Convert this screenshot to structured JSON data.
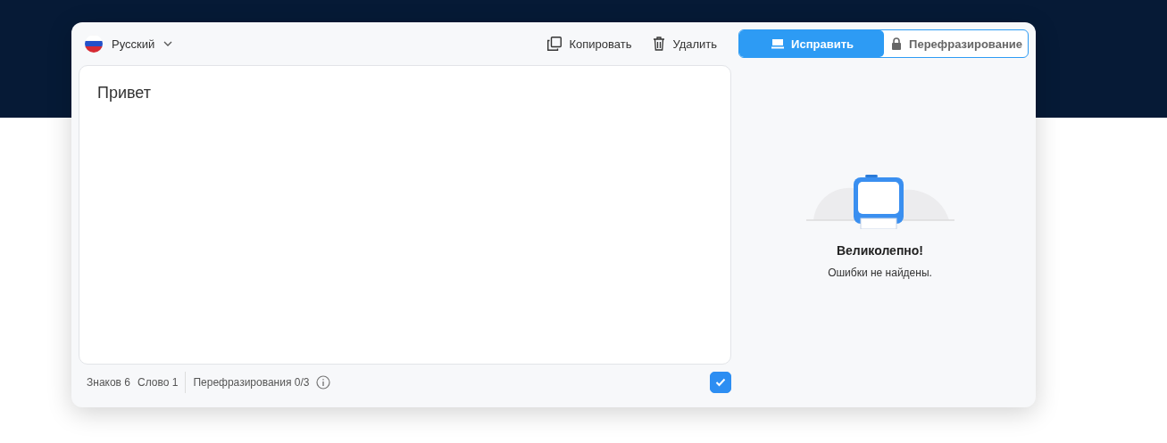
{
  "language": {
    "label": "Русский"
  },
  "actions": [
    {
      "label": "Копировать",
      "kind": "copy"
    },
    {
      "label": "Удалить",
      "kind": "delete"
    }
  ],
  "tabs": [
    {
      "label": "Исправить",
      "selected": true,
      "locked": false
    },
    {
      "label": "Перефразирование",
      "selected": false,
      "locked": true
    }
  ],
  "editor": {
    "value": "Привет"
  },
  "result": {
    "title": "Великолепно!",
    "message": "Ошибки не найдены."
  },
  "status_bar": {
    "chars": "Знаков 6",
    "words": "Слово 1",
    "paraphrases": "Перефразирования 0/3",
    "checked": true
  }
}
